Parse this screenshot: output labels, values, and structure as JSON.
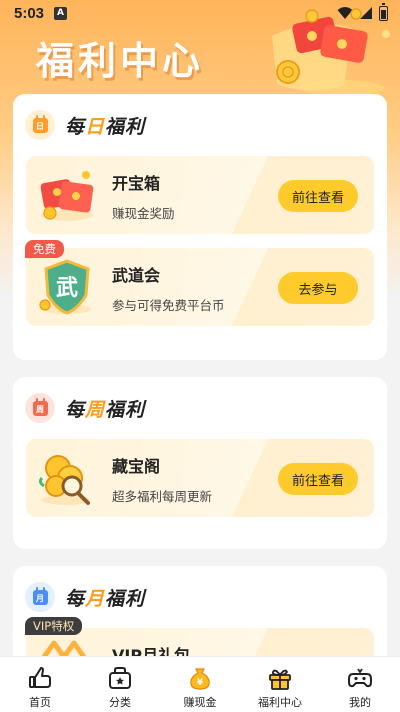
{
  "status_bar": {
    "time": "5:03",
    "notification_badge": "A"
  },
  "hero": {
    "title": "福利中心"
  },
  "sections": {
    "daily": {
      "title_prefix": "每",
      "title_highlight": "日",
      "title_suffix": "福利",
      "icon_glyph": "日",
      "items": [
        {
          "title": "开宝箱",
          "desc": "赚现金奖励",
          "button": "前往查看"
        },
        {
          "title": "武道会",
          "desc": "参与可得免费平台币",
          "button": "去参与",
          "tag": "免费",
          "emblem": "武"
        }
      ]
    },
    "weekly": {
      "title_prefix": "每",
      "title_highlight": "周",
      "title_suffix": "福利",
      "icon_glyph": "周",
      "items": [
        {
          "title": "藏宝阁",
          "desc": "超多福利每周更新",
          "button": "前往查看"
        }
      ]
    },
    "monthly": {
      "title_prefix": "每",
      "title_highlight": "月",
      "title_suffix": "福利",
      "icon_glyph": "月",
      "items": [
        {
          "title": "VIP月礼包",
          "tag": "VIP特权"
        }
      ]
    }
  },
  "bottom_nav": {
    "items": [
      {
        "label": "首页",
        "icon": "home-icon"
      },
      {
        "label": "分类",
        "icon": "category-icon"
      },
      {
        "label": "赚现金",
        "icon": "money-bag-icon",
        "glyph": "¥"
      },
      {
        "label": "福利中心",
        "icon": "gift-icon",
        "active": true
      },
      {
        "label": "我的",
        "icon": "gamepad-icon"
      }
    ]
  },
  "colors": {
    "accent": "#ffcb2c",
    "highlight_text": "#ff9c1a",
    "free_tag": "#f15a4a",
    "vip_tag": "#3d3d3d"
  }
}
